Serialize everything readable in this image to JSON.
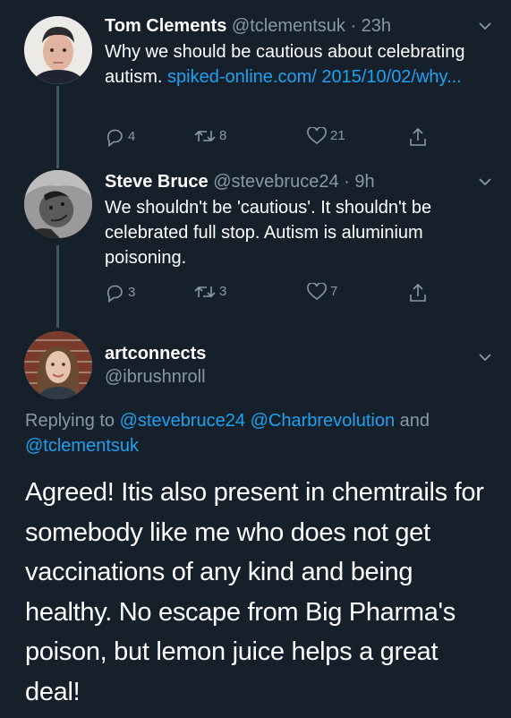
{
  "tweets": [
    {
      "name": "Tom Clements",
      "handle": "@tclementsuk",
      "time": "· 23h",
      "text": "Why we should be cautious about celebrating autism. ",
      "link": "spiked-online.com/ 2015/10/02/why...",
      "replies": "4",
      "retweets": "8",
      "likes": "21"
    },
    {
      "name": "Steve Bruce",
      "handle": "@stevebruce24",
      "time": "· 9h",
      "text": "We shouldn't be 'cautious'. It shouldn't be celebrated full stop. Autism is aluminium poisoning.",
      "replies": "3",
      "retweets": "3",
      "likes": "7"
    }
  ],
  "main_tweet": {
    "name": "artconnects",
    "handle": "@ibrushnroll",
    "replying_prefix": "Replying to ",
    "mention1": "@stevebruce24",
    "mention2": "@Charbrevolution",
    "and": " and ",
    "mention3": "@tclementsuk",
    "text": "Agreed! Itis also present in chemtrails for somebody like me who does not get vaccinations of any kind and being healthy. No escape from Big Pharma's poison, but lemon juice helps a great deal!"
  },
  "colors": {
    "background": "#15202b",
    "link": "#1da1f2",
    "muted": "#8899a6"
  }
}
